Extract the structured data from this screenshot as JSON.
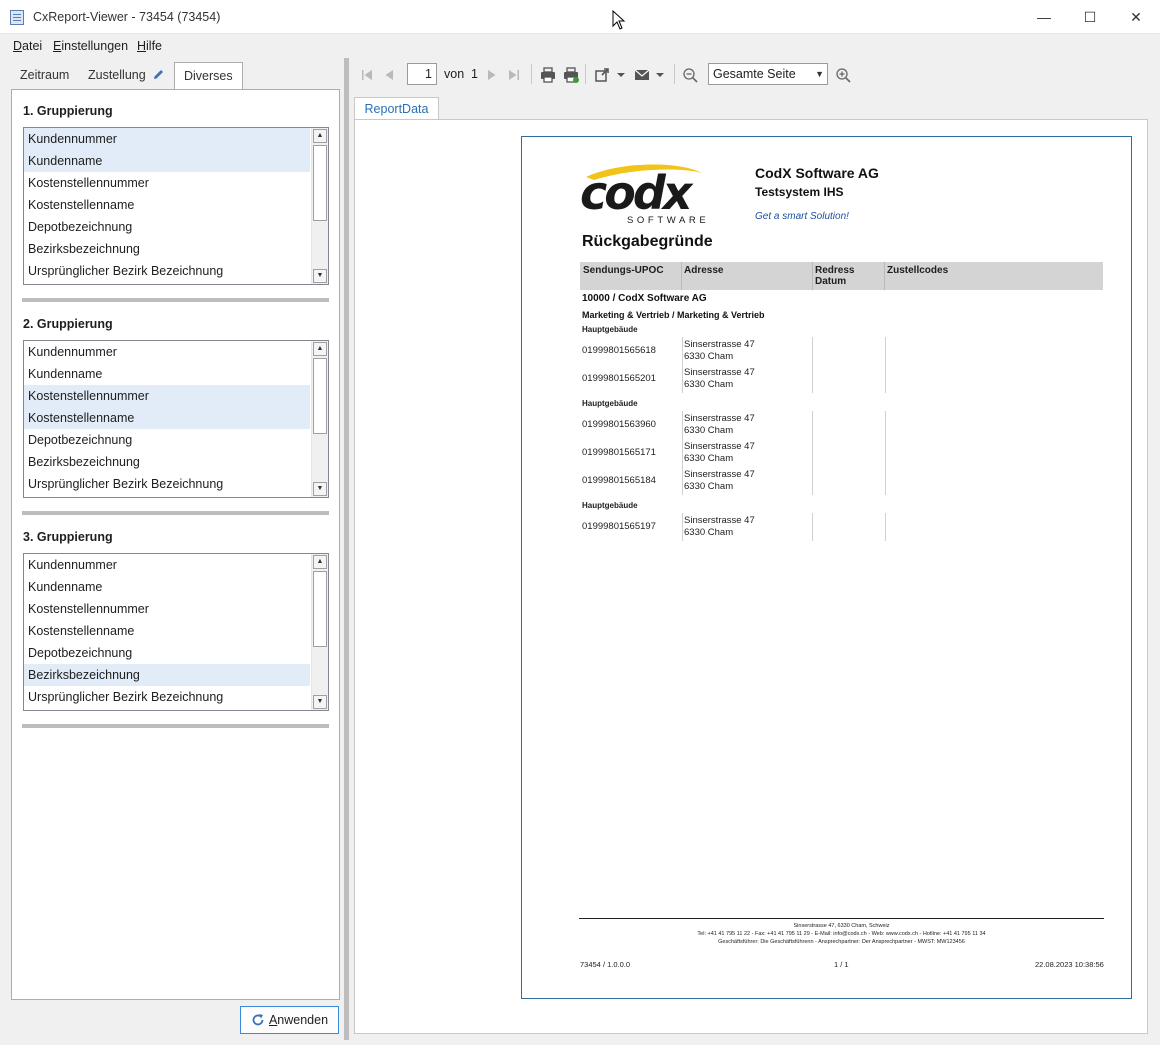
{
  "window": {
    "title": "CxReport-Viewer - 73454 (73454)",
    "min": "—",
    "max": "☐",
    "close": "✕"
  },
  "menu": {
    "items": [
      {
        "ul": "D",
        "rest": "atei"
      },
      {
        "ul": "E",
        "rest": "instellungen"
      },
      {
        "ul": "H",
        "rest": "ilfe"
      }
    ]
  },
  "left_tabs": [
    "Zeitraum",
    "Zustellung",
    "Diverses"
  ],
  "groups": [
    {
      "title": "1. Gruppierung",
      "items": [
        "Kundennummer",
        "Kundenname",
        "Kostenstellennummer",
        "Kostenstellenname",
        "Depotbezeichnung",
        "Bezirksbezeichnung",
        "Ursprünglicher Bezirk Bezeichnung"
      ],
      "selected": [
        0,
        1
      ]
    },
    {
      "title": "2. Gruppierung",
      "items": [
        "Kundennummer",
        "Kundenname",
        "Kostenstellennummer",
        "Kostenstellenname",
        "Depotbezeichnung",
        "Bezirksbezeichnung",
        "Ursprünglicher Bezirk Bezeichnung"
      ],
      "selected": [
        2,
        3
      ]
    },
    {
      "title": "3. Gruppierung",
      "items": [
        "Kundennummer",
        "Kundenname",
        "Kostenstellennummer",
        "Kostenstellenname",
        "Depotbezeichnung",
        "Bezirksbezeichnung",
        "Ursprünglicher Bezirk Bezeichnung"
      ],
      "selected": [
        5
      ]
    }
  ],
  "apply": {
    "ul": "A",
    "rest": "nwenden"
  },
  "toolbar": {
    "page": "1",
    "of_label": "von",
    "total_pages": "1",
    "zoom": "Gesamte Seite"
  },
  "report_tab": "ReportData",
  "report": {
    "logo_word": "codx",
    "logo_sub": "SOFTWARE",
    "company": "CodX Software AG",
    "system": "Testsystem IHS",
    "slogan": "Get a smart Solution!",
    "title": "Rückgabegründe",
    "columns": [
      "Sendungs-UPOC",
      "Adresse",
      "Redress Datum",
      "Zustellcodes"
    ],
    "customer": "10000 / CodX Software AG",
    "cost_center": "Marketing & Vertrieb / Marketing & Vertrieb",
    "sections": [
      {
        "depot": "Hauptgebäude",
        "rows": [
          {
            "upoc": "01999801565618",
            "street": "Sinserstrasse 47",
            "city": "6330 Cham"
          },
          {
            "upoc": "01999801565201",
            "street": "Sinserstrasse 47",
            "city": "6330 Cham"
          }
        ]
      },
      {
        "depot": "Hauptgebäude",
        "rows": [
          {
            "upoc": "01999801563960",
            "street": "Sinserstrasse 47",
            "city": "6330 Cham"
          },
          {
            "upoc": "01999801565171",
            "street": "Sinserstrasse 47",
            "city": "6330 Cham"
          },
          {
            "upoc": "01999801565184",
            "street": "Sinserstrasse 47",
            "city": "6330 Cham"
          }
        ]
      },
      {
        "depot": "Hauptgebäude",
        "rows": [
          {
            "upoc": "01999801565197",
            "street": "Sinserstrasse 47",
            "city": "6330 Cham"
          }
        ]
      }
    ],
    "footer_lines": [
      "Sinserstrasse 47, 6330 Cham, Schweiz",
      "Tel: +41 41 795 11 22 - Fax: +41 41 795 11 29 - E-Mail: info@codx.ch - Web: www.codx.ch - Hotline: +41 41 795 11 34",
      "Geschäftsführer: Die Geschäftsführenn - Ansprechpartner: Der Ansprechpartner - MWST: MW123456"
    ],
    "footer_left": "73454 / 1.0.0.0",
    "footer_center": "1 / 1",
    "footer_right": "22.08.2023 10:38:56"
  },
  "colors": {
    "selection": "#e1ecf8",
    "accent": "#2a6fb6",
    "logo_yellow": "#f2c318",
    "slogan": "#1f4fa3"
  }
}
